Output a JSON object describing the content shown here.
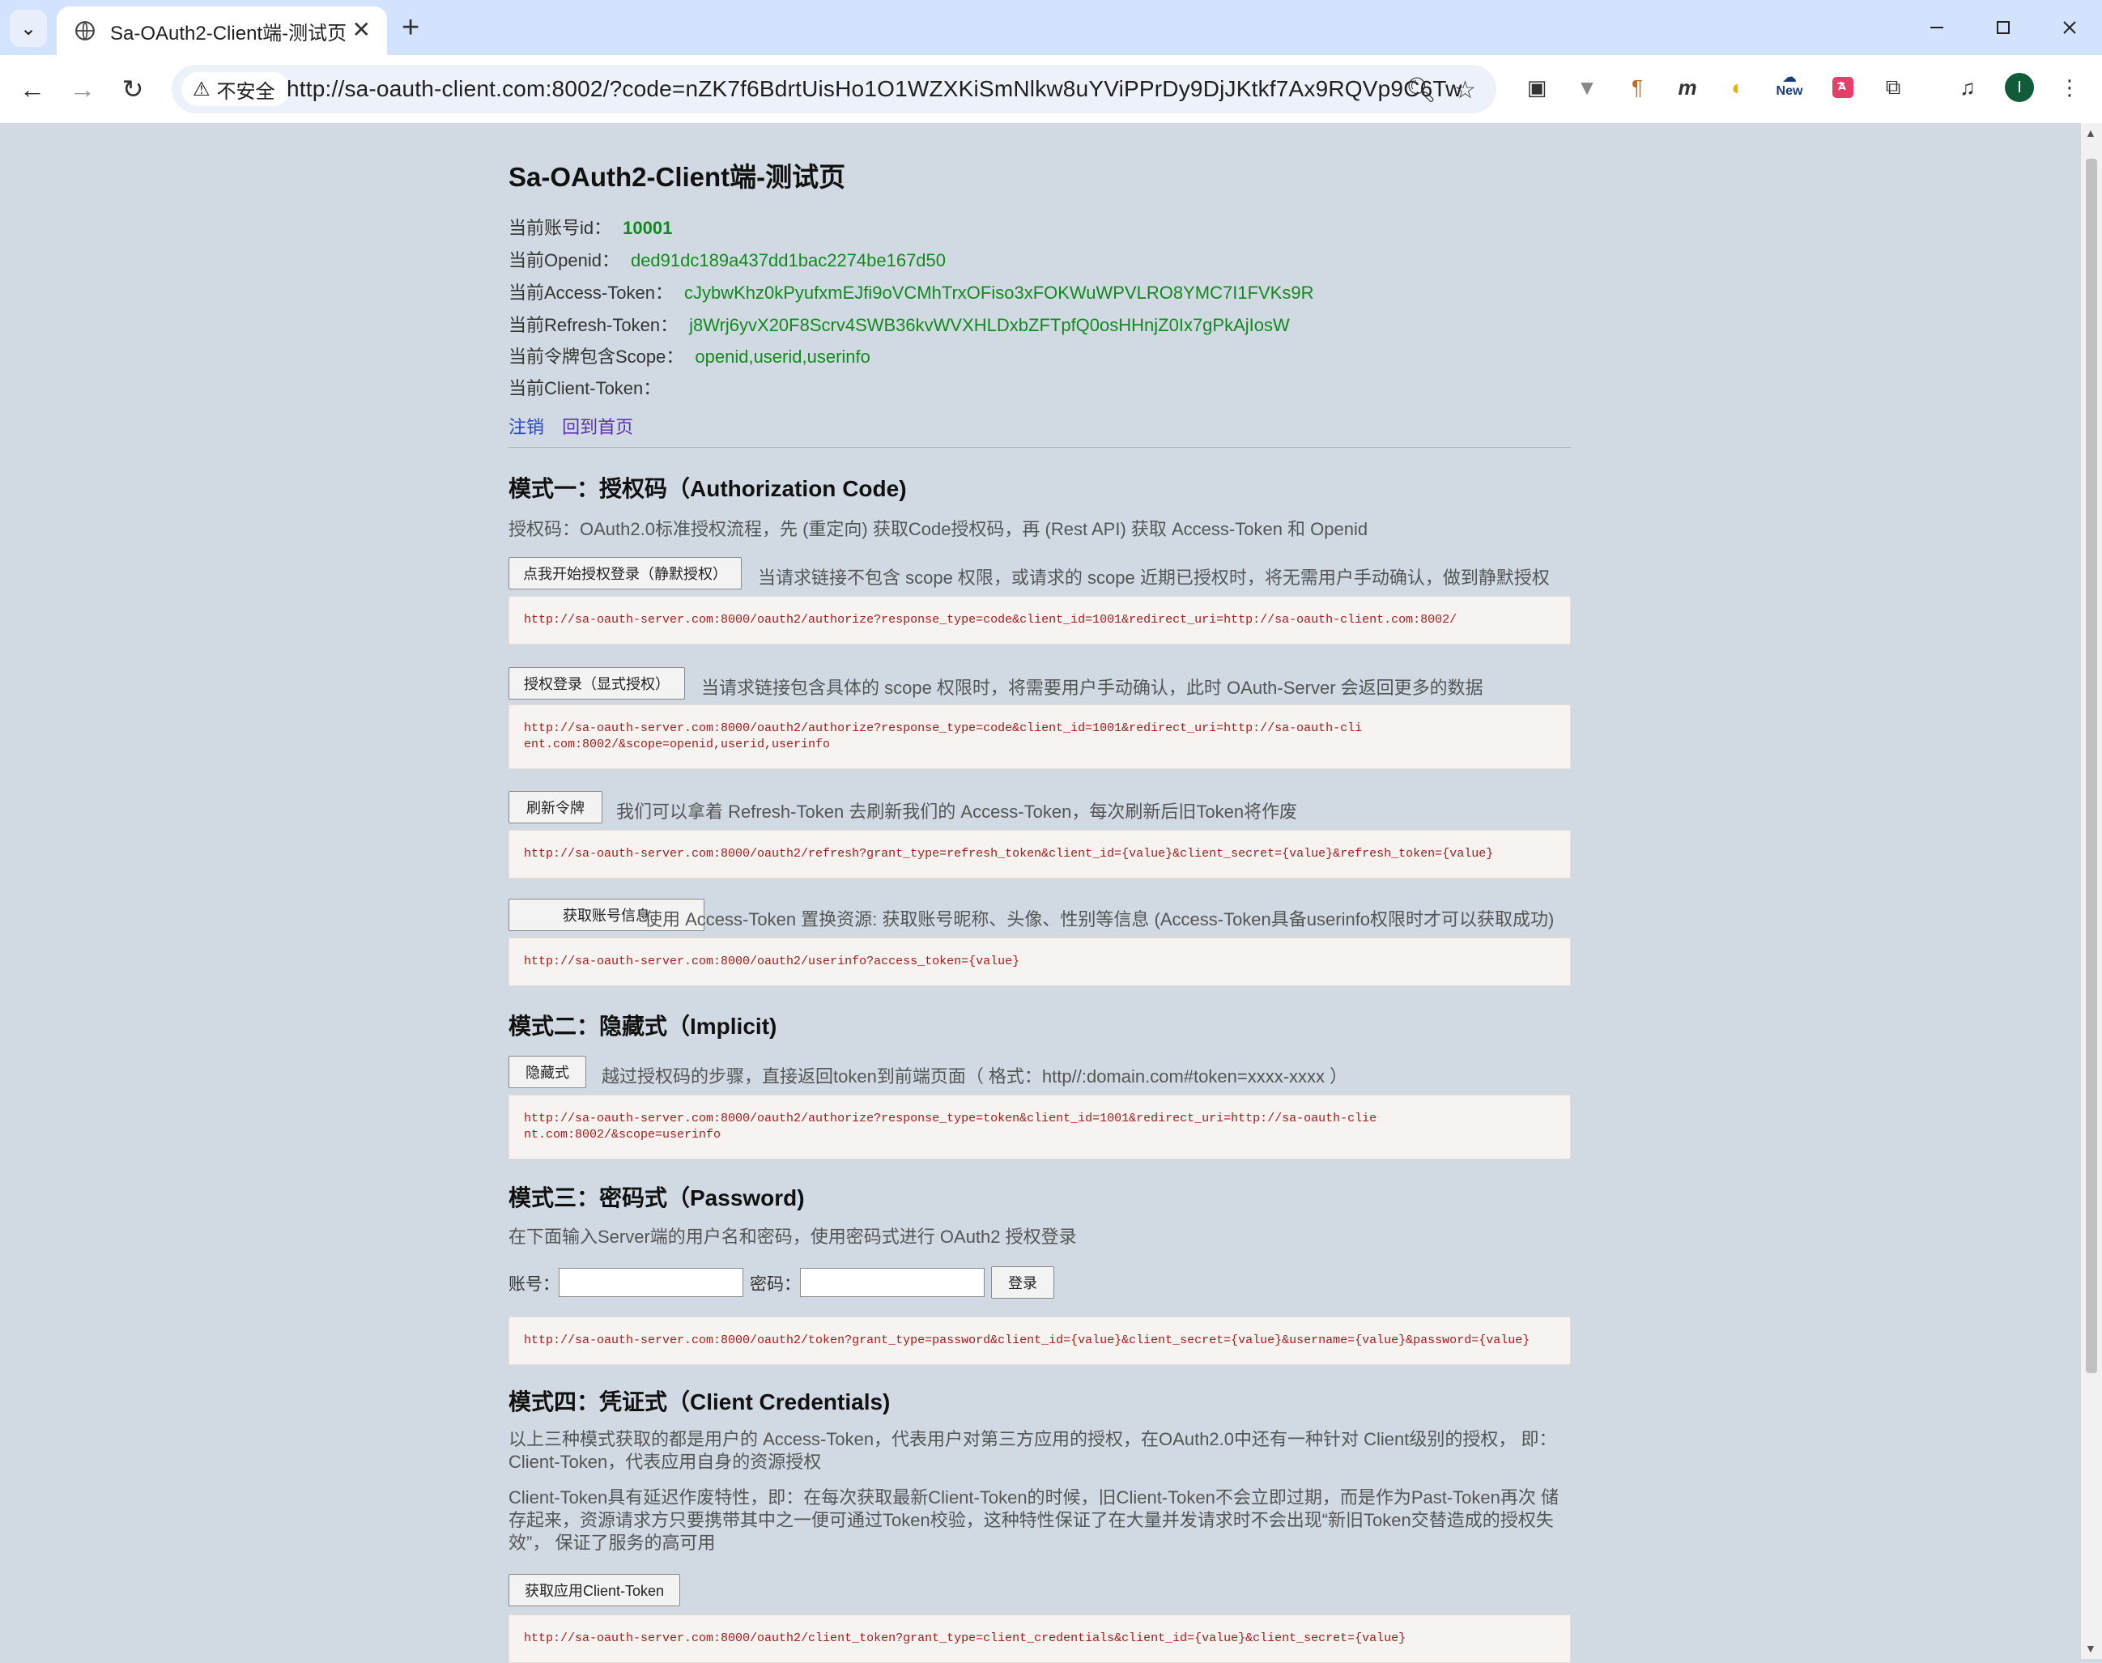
{
  "browser": {
    "tab_title": "Sa-OAuth2-Client端-测试页",
    "security_label": "不安全",
    "url": "http://sa-oauth-client.com:8002/?code=nZK7f6BdrtUisHo1O1WZXKiSmNlkw8uYViPPrDy9DjJKtkf7Ax9RQVp9C6Tw",
    "ext_new_label": "New",
    "profile_initial": "I"
  },
  "page": {
    "title": "Sa-OAuth2-Client端-测试页",
    "info": [
      {
        "label": "当前账号id：",
        "value": "10001"
      },
      {
        "label": "当前Openid：",
        "value": "ded91dc189a437dd1bac2274be167d50"
      },
      {
        "label": "当前Access-Token：",
        "value": "cJybwKhz0kPyufxmEJfi9oVCMhTrxOFiso3xFOKWuWPVLRO8YMC7I1FVKs9R"
      },
      {
        "label": "当前Refresh-Token：",
        "value": "j8Wrj6yvX20F8Scrv4SWB36kvWVXHLDxbZFTpfQ0osHHnjZ0Ix7gPkAjIosW"
      },
      {
        "label": "当前令牌包含Scope：",
        "value": "openid,userid,userinfo"
      },
      {
        "label": "当前Client-Token：",
        "value": ""
      }
    ],
    "links": {
      "logout": "注销",
      "home": "回到首页"
    },
    "mode1": {
      "title": "模式一：授权码（Authorization Code)",
      "desc": "授权码：OAuth2.0标准授权流程，先 (重定向) 获取Code授权码，再 (Rest API) 获取 Access-Token 和 Openid",
      "items": [
        {
          "button": "点我开始授权登录（静默授权）",
          "desc": "当请求链接不包含 scope 权限，或请求的 scope 近期已授权时，将无需用户手动确认，做到静默授权",
          "code": "http://sa-oauth-server.com:8000/oauth2/authorize?response_type=code&client_id=1001&redirect_uri=http://sa-oauth-client.com:8002/"
        },
        {
          "button": "授权登录（显式授权）",
          "desc": "当请求链接包含具体的 scope 权限时，将需要用户手动确认，此时 OAuth-Server 会返回更多的数据",
          "code": "http://sa-oauth-server.com:8000/oauth2/authorize?response_type=code&client_id=1001&redirect_uri=http://sa-oauth-client.com:8002/&scope=openid,userid,userinfo"
        },
        {
          "button": "刷新令牌",
          "desc": "我们可以拿着 Refresh-Token 去刷新我们的 Access-Token，每次刷新后旧Token将作废",
          "code": "http://sa-oauth-server.com:8000/oauth2/refresh?grant_type=refresh_token&client_id={value}&client_secret={value}&refresh_token={value}"
        },
        {
          "button": "获取账号信息",
          "desc": "使用 Access-Token 置换资源: 获取账号昵称、头像、性别等信息 (Access-Token具备userinfo权限时才可以获取成功)",
          "code": "http://sa-oauth-server.com:8000/oauth2/userinfo?access_token={value}"
        }
      ]
    },
    "mode2": {
      "title": "模式二：隐藏式（Implicit)",
      "button": "隐藏式",
      "desc": "越过授权码的步骤，直接返回token到前端页面（ 格式：http//:domain.com#token=xxxx-xxxx ）",
      "code": "http://sa-oauth-server.com:8000/oauth2/authorize?response_type=token&client_id=1001&redirect_uri=http://sa-oauth-client.com:8002/&scope=userinfo"
    },
    "mode3": {
      "title": "模式三：密码式（Password)",
      "desc": "在下面输入Server端的用户名和密码，使用密码式进行 OAuth2 授权登录",
      "username_label": "账号：",
      "password_label": "密码：",
      "login_button": "登录",
      "code": "http://sa-oauth-server.com:8000/oauth2/token?grant_type=password&client_id={value}&client_secret={value}&username={value}&password={value}"
    },
    "mode4": {
      "title": "模式四：凭证式（Client Credentials)",
      "desc1": "以上三种模式获取的都是用户的 Access-Token，代表用户对第三方应用的授权，在OAuth2.0中还有一种针对 Client级别的授权， 即：Client-Token，代表应用自身的资源授权",
      "desc2": "Client-Token具有延迟作废特性，即：在每次获取最新Client-Token的时候，旧Client-Token不会立即过期，而是作为Past-Token再次 储存起来，资源请求方只要携带其中之一便可通过Token校验，这种特性保证了在大量并发请求时不会出现“新旧Token交替造成的授权失效”， 保证了服务的高可用",
      "button": "获取应用Client-Token",
      "code": "http://sa-oauth-server.com:8000/oauth2/client_token?grant_type=client_credentials&client_id={value}&client_secret={value}"
    }
  }
}
